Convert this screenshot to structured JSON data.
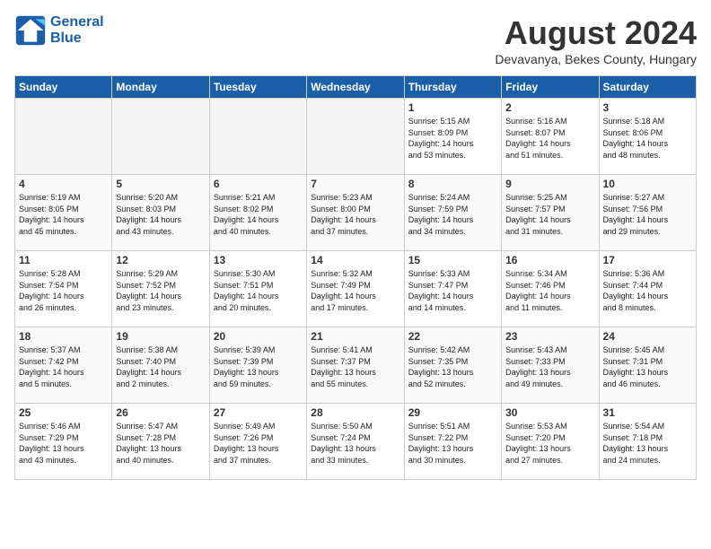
{
  "logo": {
    "line1": "General",
    "line2": "Blue"
  },
  "title": "August 2024",
  "location": "Devavanya, Bekes County, Hungary",
  "days_of_week": [
    "Sunday",
    "Monday",
    "Tuesday",
    "Wednesday",
    "Thursday",
    "Friday",
    "Saturday"
  ],
  "weeks": [
    [
      {
        "num": "",
        "info": ""
      },
      {
        "num": "",
        "info": ""
      },
      {
        "num": "",
        "info": ""
      },
      {
        "num": "",
        "info": ""
      },
      {
        "num": "1",
        "info": "Sunrise: 5:15 AM\nSunset: 8:09 PM\nDaylight: 14 hours\nand 53 minutes."
      },
      {
        "num": "2",
        "info": "Sunrise: 5:16 AM\nSunset: 8:07 PM\nDaylight: 14 hours\nand 51 minutes."
      },
      {
        "num": "3",
        "info": "Sunrise: 5:18 AM\nSunset: 8:06 PM\nDaylight: 14 hours\nand 48 minutes."
      }
    ],
    [
      {
        "num": "4",
        "info": "Sunrise: 5:19 AM\nSunset: 8:05 PM\nDaylight: 14 hours\nand 45 minutes."
      },
      {
        "num": "5",
        "info": "Sunrise: 5:20 AM\nSunset: 8:03 PM\nDaylight: 14 hours\nand 43 minutes."
      },
      {
        "num": "6",
        "info": "Sunrise: 5:21 AM\nSunset: 8:02 PM\nDaylight: 14 hours\nand 40 minutes."
      },
      {
        "num": "7",
        "info": "Sunrise: 5:23 AM\nSunset: 8:00 PM\nDaylight: 14 hours\nand 37 minutes."
      },
      {
        "num": "8",
        "info": "Sunrise: 5:24 AM\nSunset: 7:59 PM\nDaylight: 14 hours\nand 34 minutes."
      },
      {
        "num": "9",
        "info": "Sunrise: 5:25 AM\nSunset: 7:57 PM\nDaylight: 14 hours\nand 31 minutes."
      },
      {
        "num": "10",
        "info": "Sunrise: 5:27 AM\nSunset: 7:56 PM\nDaylight: 14 hours\nand 29 minutes."
      }
    ],
    [
      {
        "num": "11",
        "info": "Sunrise: 5:28 AM\nSunset: 7:54 PM\nDaylight: 14 hours\nand 26 minutes."
      },
      {
        "num": "12",
        "info": "Sunrise: 5:29 AM\nSunset: 7:52 PM\nDaylight: 14 hours\nand 23 minutes."
      },
      {
        "num": "13",
        "info": "Sunrise: 5:30 AM\nSunset: 7:51 PM\nDaylight: 14 hours\nand 20 minutes."
      },
      {
        "num": "14",
        "info": "Sunrise: 5:32 AM\nSunset: 7:49 PM\nDaylight: 14 hours\nand 17 minutes."
      },
      {
        "num": "15",
        "info": "Sunrise: 5:33 AM\nSunset: 7:47 PM\nDaylight: 14 hours\nand 14 minutes."
      },
      {
        "num": "16",
        "info": "Sunrise: 5:34 AM\nSunset: 7:46 PM\nDaylight: 14 hours\nand 11 minutes."
      },
      {
        "num": "17",
        "info": "Sunrise: 5:36 AM\nSunset: 7:44 PM\nDaylight: 14 hours\nand 8 minutes."
      }
    ],
    [
      {
        "num": "18",
        "info": "Sunrise: 5:37 AM\nSunset: 7:42 PM\nDaylight: 14 hours\nand 5 minutes."
      },
      {
        "num": "19",
        "info": "Sunrise: 5:38 AM\nSunset: 7:40 PM\nDaylight: 14 hours\nand 2 minutes."
      },
      {
        "num": "20",
        "info": "Sunrise: 5:39 AM\nSunset: 7:39 PM\nDaylight: 13 hours\nand 59 minutes."
      },
      {
        "num": "21",
        "info": "Sunrise: 5:41 AM\nSunset: 7:37 PM\nDaylight: 13 hours\nand 55 minutes."
      },
      {
        "num": "22",
        "info": "Sunrise: 5:42 AM\nSunset: 7:35 PM\nDaylight: 13 hours\nand 52 minutes."
      },
      {
        "num": "23",
        "info": "Sunrise: 5:43 AM\nSunset: 7:33 PM\nDaylight: 13 hours\nand 49 minutes."
      },
      {
        "num": "24",
        "info": "Sunrise: 5:45 AM\nSunset: 7:31 PM\nDaylight: 13 hours\nand 46 minutes."
      }
    ],
    [
      {
        "num": "25",
        "info": "Sunrise: 5:46 AM\nSunset: 7:29 PM\nDaylight: 13 hours\nand 43 minutes."
      },
      {
        "num": "26",
        "info": "Sunrise: 5:47 AM\nSunset: 7:28 PM\nDaylight: 13 hours\nand 40 minutes."
      },
      {
        "num": "27",
        "info": "Sunrise: 5:49 AM\nSunset: 7:26 PM\nDaylight: 13 hours\nand 37 minutes."
      },
      {
        "num": "28",
        "info": "Sunrise: 5:50 AM\nSunset: 7:24 PM\nDaylight: 13 hours\nand 33 minutes."
      },
      {
        "num": "29",
        "info": "Sunrise: 5:51 AM\nSunset: 7:22 PM\nDaylight: 13 hours\nand 30 minutes."
      },
      {
        "num": "30",
        "info": "Sunrise: 5:53 AM\nSunset: 7:20 PM\nDaylight: 13 hours\nand 27 minutes."
      },
      {
        "num": "31",
        "info": "Sunrise: 5:54 AM\nSunset: 7:18 PM\nDaylight: 13 hours\nand 24 minutes."
      }
    ]
  ]
}
